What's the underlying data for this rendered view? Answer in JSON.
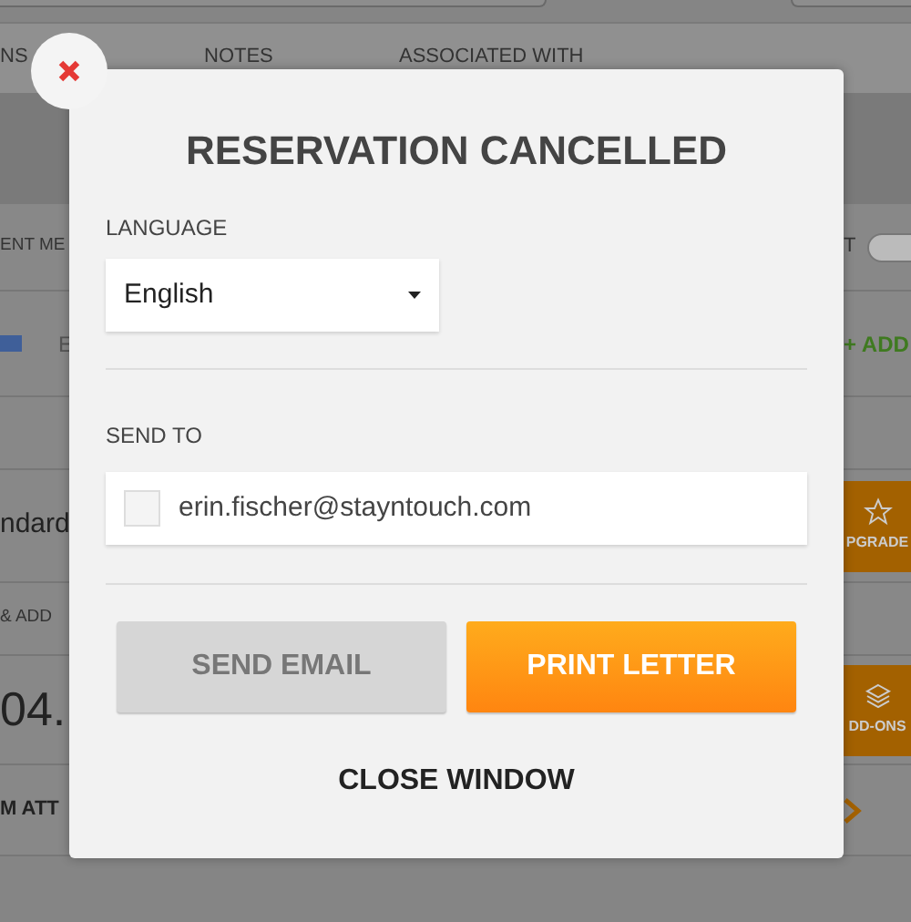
{
  "background": {
    "tabs": [
      {
        "label": "NS"
      },
      {
        "label": "NOTES"
      },
      {
        "label": "ASSOCIATED WITH"
      }
    ],
    "rows": [
      {
        "left": {
          "kind": "label",
          "text": "ENT ME"
        },
        "right": {
          "kind": "toggle",
          "text": "T",
          "on": false
        }
      },
      {
        "left": {
          "kind": "card",
          "text": "E"
        },
        "right": {
          "kind": "link",
          "text": "+ ADD"
        }
      },
      {},
      {
        "left": {
          "kind": "value",
          "text": "ndard"
        },
        "right": {
          "kind": "star-tile",
          "text": "PGRADE"
        }
      },
      {
        "left": {
          "kind": "label",
          "text": "& ADD"
        }
      },
      {
        "left": {
          "kind": "big",
          "text": "04."
        },
        "right": {
          "kind": "layers-tile",
          "text": "DD-ONS"
        }
      },
      {
        "left": {
          "kind": "heading",
          "text": "M ATT"
        },
        "right": {
          "kind": "chevron"
        }
      }
    ]
  },
  "dialog": {
    "title": "RESERVATION CANCELLED",
    "language": {
      "label": "LANGUAGE",
      "value": "English"
    },
    "send_to": {
      "label": "SEND TO",
      "recipients": [
        {
          "email": "erin.fischer@stayntouch.com",
          "checked": false
        }
      ]
    },
    "buttons": [
      {
        "label": "SEND EMAIL",
        "disabled": true
      },
      {
        "label": "PRINT LETTER",
        "disabled": false
      }
    ],
    "close": "CLOSE WINDOW"
  }
}
